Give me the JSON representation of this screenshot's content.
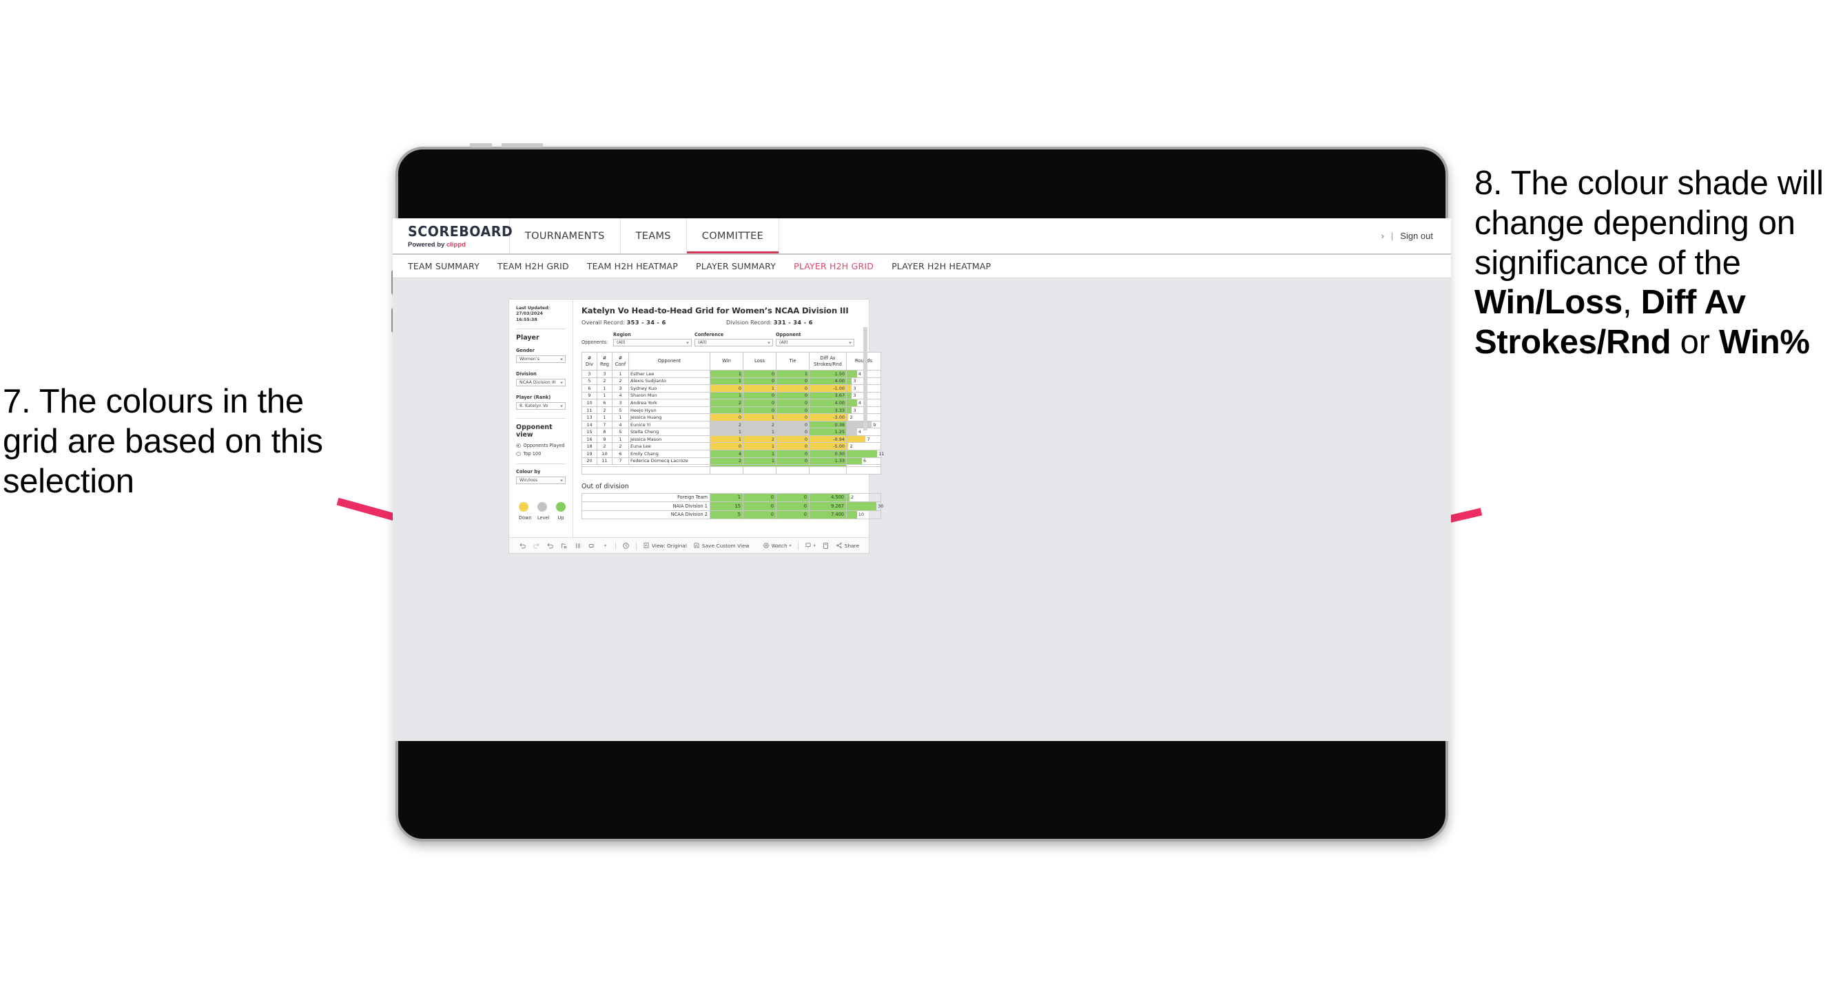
{
  "annotations": {
    "left": {
      "name": "annotation-7",
      "text": "7. The colours in the grid are based on this selection"
    },
    "right": {
      "name": "annotation-8",
      "prefix": "8. The colour shade will change depending on significance of the ",
      "bold1": "Win/Loss",
      "mid1": ", ",
      "bold2": "Diff Av Strokes/Rnd",
      "mid2": " or ",
      "bold3": "Win%",
      "full": "8. The colour shade will change depending on significance of the Win/Loss, Diff Av Strokes/Rnd or Win%"
    },
    "arrow_color": "#ec2d63"
  },
  "app": {
    "brand": {
      "title": "SCOREBOARD",
      "powered_prefix": "Powered by ",
      "powered_brand": "clippd"
    },
    "top_nav": [
      {
        "label": "TOURNAMENTS",
        "active": false
      },
      {
        "label": "TEAMS",
        "active": false
      },
      {
        "label": "COMMITTEE",
        "active": true
      }
    ],
    "top_right": {
      "chevron": "›",
      "separator": "|",
      "sign_out": "Sign out"
    },
    "sub_nav": [
      {
        "label": "TEAM SUMMARY",
        "active": false
      },
      {
        "label": "TEAM H2H GRID",
        "active": false
      },
      {
        "label": "TEAM H2H HEATMAP",
        "active": false
      },
      {
        "label": "PLAYER SUMMARY",
        "active": false
      },
      {
        "label": "PLAYER H2H GRID",
        "active": true
      },
      {
        "label": "PLAYER H2H HEATMAP",
        "active": false
      }
    ],
    "accent_color": "#e4456b"
  },
  "filters": {
    "last_updated_line1": "Last Updated: 27/03/2024",
    "last_updated_line2": "16:55:38",
    "player_heading": "Player",
    "gender": {
      "label": "Gender",
      "value": "Women’s"
    },
    "division": {
      "label": "Division",
      "value": "NCAA Division III"
    },
    "player_rank": {
      "label": "Player (Rank)",
      "value": "8. Katelyn Vo"
    },
    "opponent_view": {
      "heading": "Opponent view",
      "options": [
        {
          "label": "Opponents Played",
          "selected": true
        },
        {
          "label": "Top 100",
          "selected": false
        }
      ]
    },
    "colour_by": {
      "label": "Colour by",
      "value": "Win/loss"
    },
    "legend": [
      {
        "label": "Down",
        "color": "#f2d24f"
      },
      {
        "label": "Level",
        "color": "#c4c4c4"
      },
      {
        "label": "Up",
        "color": "#86cc5e"
      }
    ]
  },
  "viz": {
    "title": "Katelyn Vo Head-to-Head Grid for Women’s NCAA Division III",
    "overall_record_label": "Overall Record: ",
    "overall_record_value": "353 -  34 - 6",
    "division_record_label": "Division Record: ",
    "division_record_value": "331 -  34 - 6",
    "opponents_label": "Opponents:",
    "opponent_filters": [
      {
        "label": "Region",
        "value": "(All)"
      },
      {
        "label": "Conference",
        "value": "(All)"
      },
      {
        "label": "Opponent",
        "value": "(All)"
      }
    ],
    "out_of_division_title": "Out of division"
  },
  "chart_data": {
    "type": "table",
    "title": "Katelyn Vo Head-to-Head Grid for Women’s NCAA Division III",
    "columns": [
      "# Div",
      "# Reg",
      "# Conf",
      "Opponent",
      "Win",
      "Loss",
      "Tie",
      "Diff Av Strokes/Rnd",
      "Rounds"
    ],
    "column_headers_two_line": [
      {
        "l1": "#",
        "l2": "Div"
      },
      {
        "l1": "#",
        "l2": "Reg"
      },
      {
        "l1": "#",
        "l2": "Conf"
      },
      {
        "l1": "Opponent",
        "l2": ""
      },
      {
        "l1": "Win",
        "l2": ""
      },
      {
        "l1": "Loss",
        "l2": ""
      },
      {
        "l1": "Tie",
        "l2": ""
      },
      {
        "l1": "Diff Av",
        "l2": "Strokes/Rnd"
      },
      {
        "l1": "Rounds",
        "l2": ""
      }
    ],
    "rows": [
      {
        "div": "3",
        "reg": "3",
        "conf": "1",
        "opponent": "Esther Lee",
        "win": "1",
        "loss": "0",
        "tie": "1",
        "diff": "1.50",
        "rounds": "4",
        "rounds_pct": 30,
        "color": "g"
      },
      {
        "div": "5",
        "reg": "2",
        "conf": "2",
        "opponent": "Alexis Sudjianto",
        "win": "1",
        "loss": "0",
        "tie": "0",
        "diff": "4.00",
        "rounds": "3",
        "rounds_pct": 15,
        "color": "g"
      },
      {
        "div": "6",
        "reg": "1",
        "conf": "3",
        "opponent": "Sydney Kuo",
        "win": "0",
        "loss": "1",
        "tie": "0",
        "diff": "-1.00",
        "rounds": "3",
        "rounds_pct": 15,
        "color": "y"
      },
      {
        "div": "9",
        "reg": "1",
        "conf": "4",
        "opponent": "Sharon Mun",
        "win": "1",
        "loss": "0",
        "tie": "0",
        "diff": "3.67",
        "rounds": "3",
        "rounds_pct": 15,
        "color": "g"
      },
      {
        "div": "10",
        "reg": "6",
        "conf": "3",
        "opponent": "Andrea York",
        "win": "2",
        "loss": "0",
        "tie": "0",
        "diff": "4.00",
        "rounds": "4",
        "rounds_pct": 30,
        "color": "g"
      },
      {
        "div": "11",
        "reg": "2",
        "conf": "5",
        "opponent": "Heejo Hyun",
        "win": "1",
        "loss": "0",
        "tie": "0",
        "diff": "3.33",
        "rounds": "3",
        "rounds_pct": 15,
        "color": "g"
      },
      {
        "div": "13",
        "reg": "1",
        "conf": "1",
        "opponent": "Jessica Huang",
        "win": "0",
        "loss": "1",
        "tie": "0",
        "diff": "-3.00",
        "rounds": "2",
        "rounds_pct": 5,
        "color": "y"
      },
      {
        "div": "14",
        "reg": "7",
        "conf": "4",
        "opponent": "Eunice Yi",
        "win": "2",
        "loss": "2",
        "tie": "0",
        "diff": "0.38",
        "rounds": "9",
        "rounds_pct": 74,
        "color": "gr",
        "diff_color": "g"
      },
      {
        "div": "15",
        "reg": "8",
        "conf": "5",
        "opponent": "Stella Cheng",
        "win": "1",
        "loss": "1",
        "tie": "0",
        "diff": "1.25",
        "rounds": "4",
        "rounds_pct": 30,
        "color": "gr",
        "diff_color": "g"
      },
      {
        "div": "16",
        "reg": "9",
        "conf": "1",
        "opponent": "Jessica Mason",
        "win": "1",
        "loss": "2",
        "tie": "0",
        "diff": "-0.94",
        "rounds": "7",
        "rounds_pct": 56,
        "color": "y"
      },
      {
        "div": "18",
        "reg": "2",
        "conf": "2",
        "opponent": "Euna Lee",
        "win": "0",
        "loss": "1",
        "tie": "0",
        "diff": "-5.00",
        "rounds": "2",
        "rounds_pct": 5,
        "color": "y"
      },
      {
        "div": "19",
        "reg": "10",
        "conf": "6",
        "opponent": "Emily Chang",
        "win": "4",
        "loss": "1",
        "tie": "0",
        "diff": "0.30",
        "rounds": "11",
        "rounds_pct": 90,
        "color": "g"
      },
      {
        "div": "20",
        "reg": "11",
        "conf": "7",
        "opponent": "Federica Domecq Lacroze",
        "win": "2",
        "loss": "1",
        "tie": "0",
        "diff": "1.33",
        "rounds": "6",
        "rounds_pct": 45,
        "color": "g"
      }
    ],
    "out_of_division": {
      "title": "Out of division",
      "rows": [
        {
          "label": "Foreign Team",
          "win": "1",
          "loss": "0",
          "tie": "0",
          "diff": "4.500",
          "rounds": "2",
          "rounds_pct": 8,
          "color": "g"
        },
        {
          "label": "NAIA Division 1",
          "win": "15",
          "loss": "0",
          "tie": "0",
          "diff": "9.267",
          "rounds": "30",
          "rounds_pct": 88,
          "color": "g"
        },
        {
          "label": "NCAA Division 2",
          "win": "5",
          "loss": "0",
          "tie": "0",
          "diff": "7.400",
          "rounds": "10",
          "rounds_pct": 30,
          "color": "g"
        }
      ]
    },
    "colors": {
      "up": "#90d166",
      "down": "#f2d24f",
      "level": "#cccccc"
    }
  },
  "toolbar": {
    "view_label": "View: Original",
    "save_label": "Save Custom View",
    "watch_label": "Watch",
    "share_label": "Share"
  }
}
